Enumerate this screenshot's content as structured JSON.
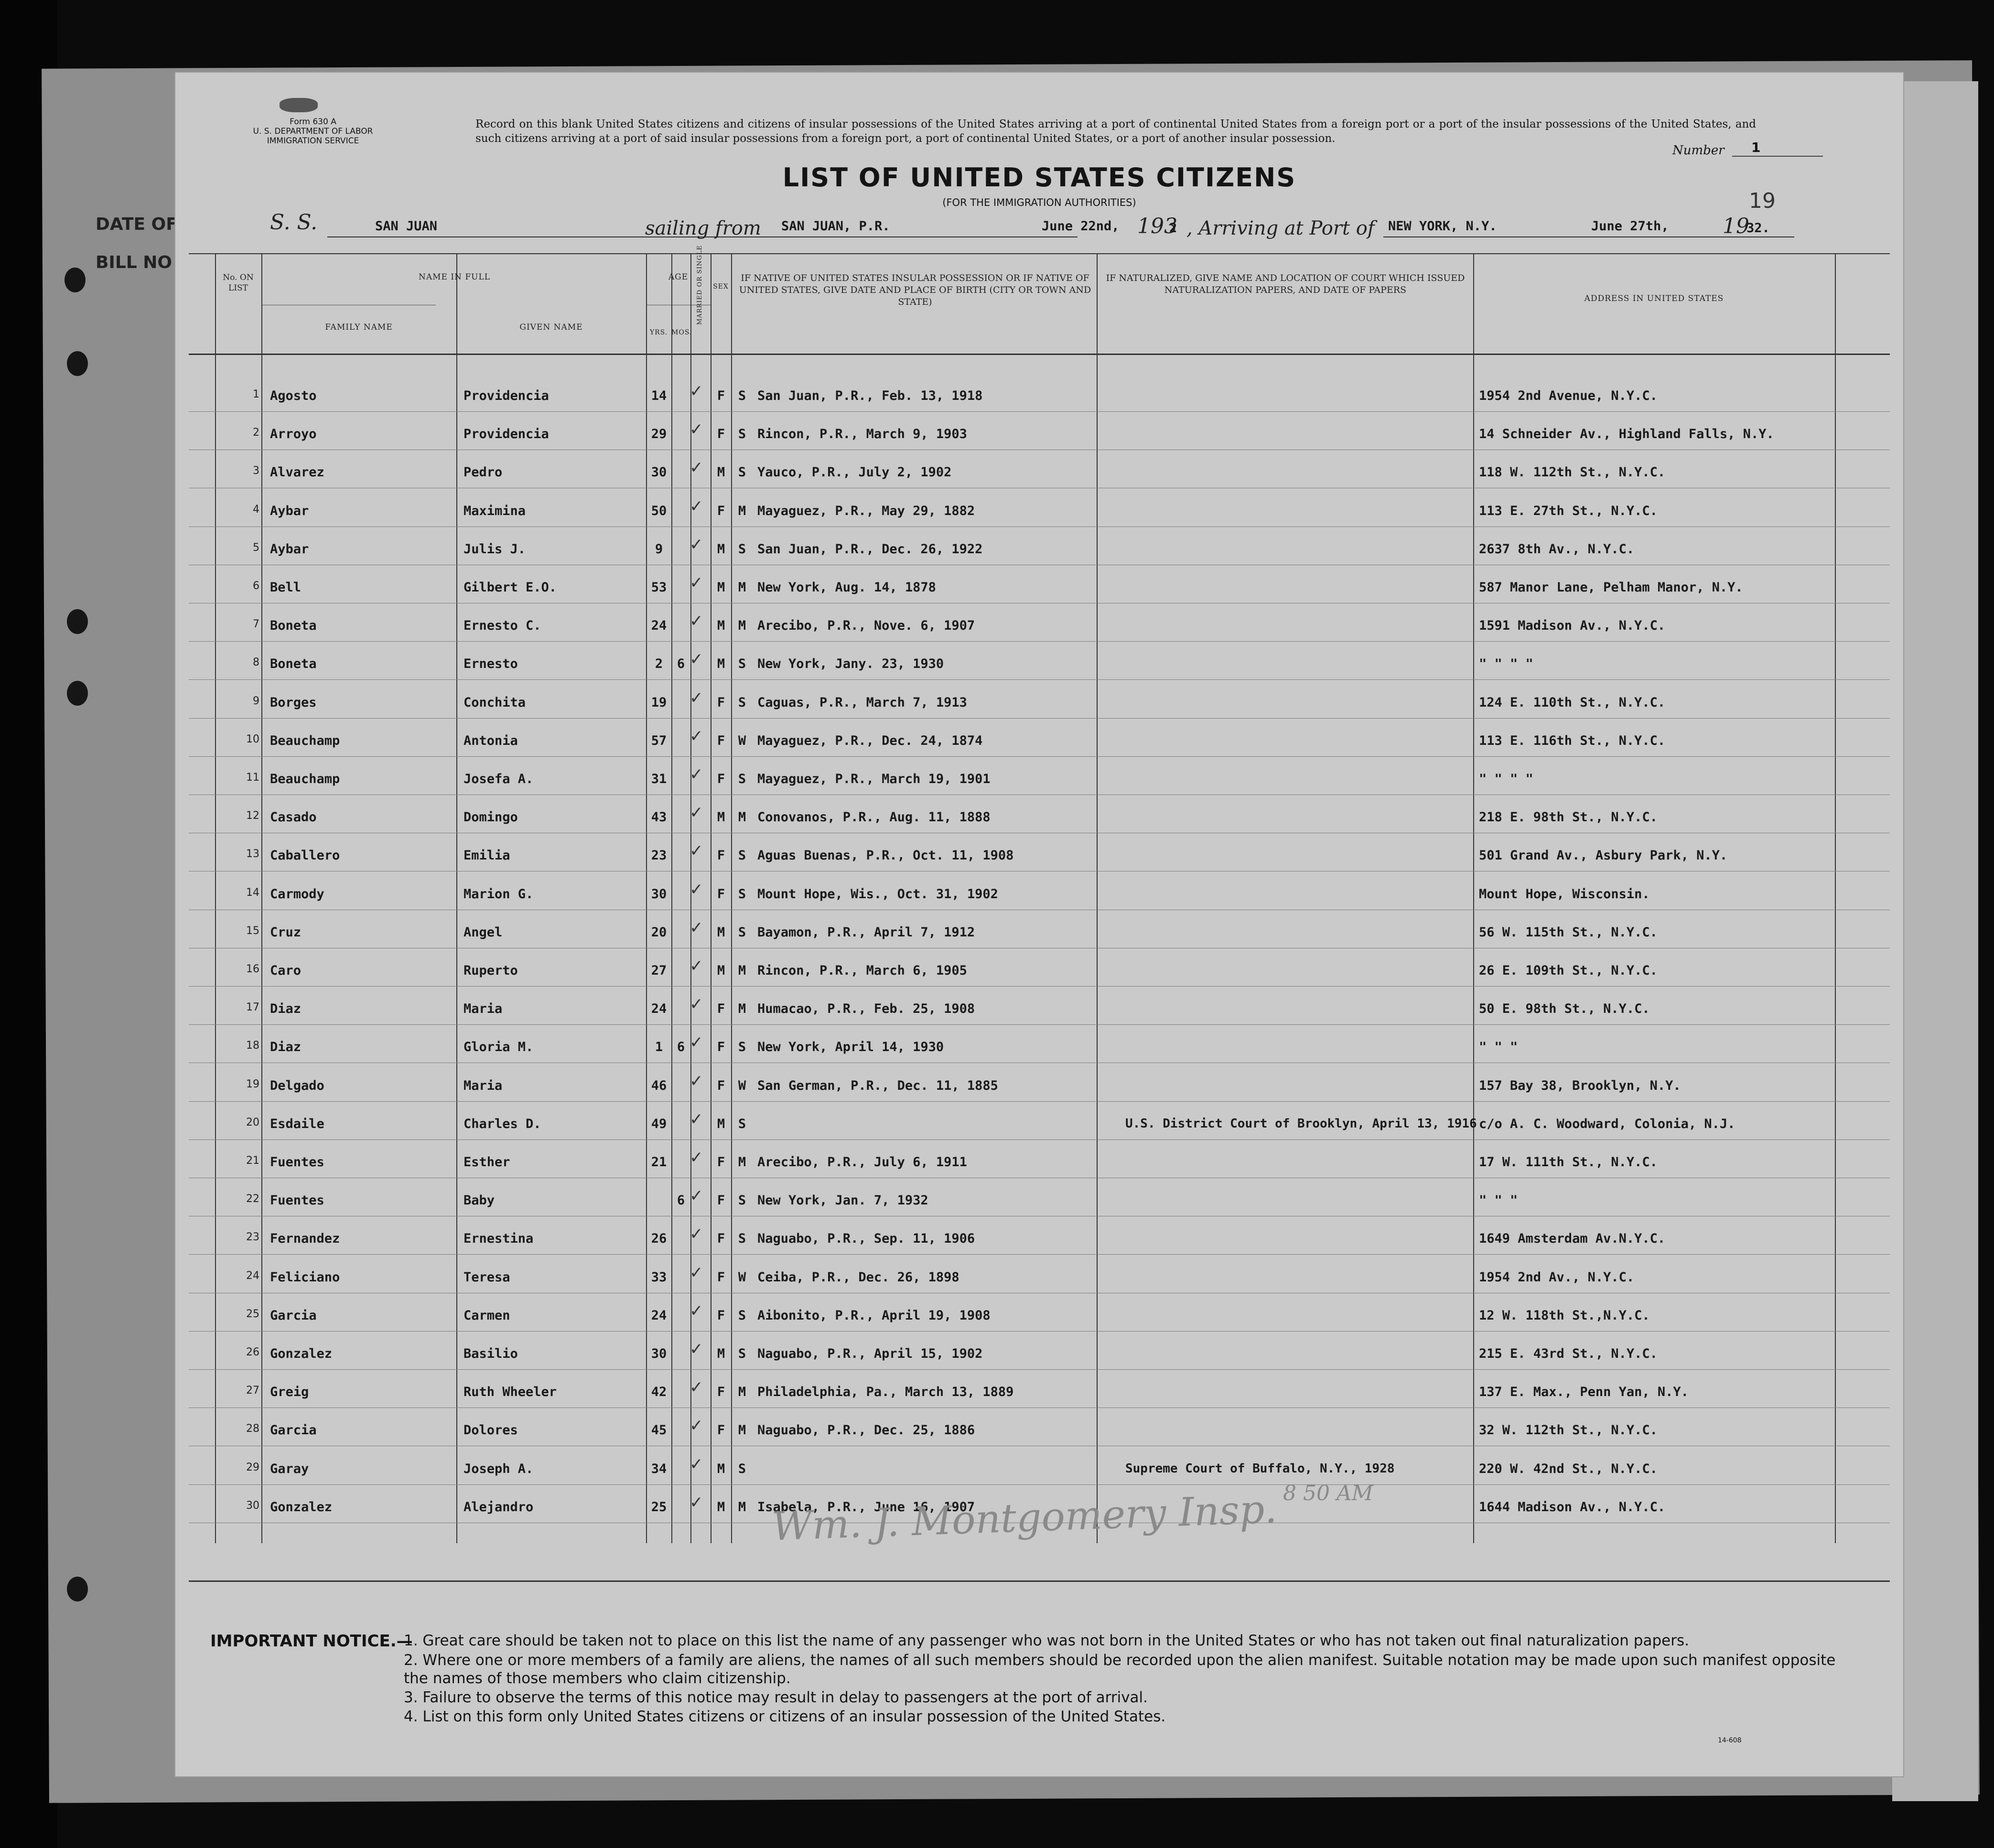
{
  "under_sheet": {
    "left_labels": [
      "DATE OF",
      "BILL NO"
    ]
  },
  "form": {
    "form_number": "Form 630 A",
    "department": "U. S. DEPARTMENT OF LABOR",
    "service": "IMMIGRATION SERVICE",
    "record_note": "Record on this blank United States citizens and citizens of insular possessions of the United States arriving at a port of continental United States from a foreign port or a port of the insular possessions of the United States, and such citizens arriving at a port of said insular possessions from a foreign port, a port of continental United States, or a port of another insular possession.",
    "number_label": "Number",
    "number_value": "1",
    "page_number": "19",
    "form_code": "14-608"
  },
  "title": "LIST OF UNITED STATES CITIZENS",
  "subtitle": "(FOR THE IMMIGRATION AUTHORITIES)",
  "voyage": {
    "ss_label": "S. S.",
    "ship": "SAN JUAN",
    "sailing_label": "sailing from",
    "from_port": "SAN JUAN, P.R.",
    "sail_date": "June 22nd,",
    "year_prefix": "193",
    "sail_year": "2",
    "arriving_label": ", Arriving at Port of",
    "to_port": "NEW YORK, N.Y.",
    "arrive_date": "June 27th,",
    "arrive_year_prefix": "19",
    "arrive_year": "32."
  },
  "headers": {
    "no_on_list": "No. ON LIST",
    "name_in_full": "NAME IN FULL",
    "family_name": "FAMILY NAME",
    "given_name": "GIVEN NAME",
    "age": "AGE",
    "yrs": "YRS.",
    "mos": "MOS.",
    "sex": "SEX",
    "married": "MARRIED OR SINGLE",
    "birth": "IF NATIVE OF UNITED STATES INSULAR POSSESSION OR IF NATIVE OF UNITED STATES, GIVE DATE AND PLACE OF BIRTH (CITY OR TOWN AND STATE)",
    "naturalized": "IF NATURALIZED, GIVE NAME AND LOCATION OF COURT WHICH ISSUED NATURALIZATION PAPERS, AND DATE OF PAPERS",
    "address": "ADDRESS IN UNITED STATES"
  },
  "passengers": [
    {
      "no": "1",
      "family": "Agosto",
      "given": "Providencia",
      "yrs": "14",
      "mos": "",
      "sex": "F",
      "ms": "S",
      "birth": "San Juan, P.R., Feb. 13, 1918",
      "nat": "",
      "addr": "1954 2nd Avenue, N.Y.C."
    },
    {
      "no": "2",
      "family": "Arroyo",
      "given": "Providencia",
      "yrs": "29",
      "mos": "",
      "sex": "F",
      "ms": "S",
      "birth": "Rincon, P.R., March 9, 1903",
      "nat": "",
      "addr": "14 Schneider Av., Highland Falls, N.Y."
    },
    {
      "no": "3",
      "family": "Alvarez",
      "given": "Pedro",
      "yrs": "30",
      "mos": "",
      "sex": "M",
      "ms": "S",
      "birth": "Yauco, P.R., July 2, 1902",
      "nat": "",
      "addr": "118 W. 112th St., N.Y.C."
    },
    {
      "no": "4",
      "family": "Aybar",
      "given": "Maximina",
      "yrs": "50",
      "mos": "",
      "sex": "F",
      "ms": "M",
      "birth": "Mayaguez, P.R., May 29, 1882",
      "nat": "",
      "addr": "113 E. 27th St., N.Y.C."
    },
    {
      "no": "5",
      "family": "Aybar",
      "given": "Julis J.",
      "yrs": "9",
      "mos": "",
      "sex": "M",
      "ms": "S",
      "birth": "San Juan, P.R., Dec. 26, 1922",
      "nat": "",
      "addr": "2637 8th Av., N.Y.C."
    },
    {
      "no": "6",
      "family": "Bell",
      "given": "Gilbert E.O.",
      "yrs": "53",
      "mos": "",
      "sex": "M",
      "ms": "M",
      "birth": "New York, Aug. 14, 1878",
      "nat": "",
      "addr": "587 Manor Lane, Pelham Manor, N.Y."
    },
    {
      "no": "7",
      "family": "Boneta",
      "given": "Ernesto C.",
      "yrs": "24",
      "mos": "",
      "sex": "M",
      "ms": "M",
      "birth": "Arecibo, P.R., Nove. 6, 1907",
      "nat": "",
      "addr": "1591 Madison Av., N.Y.C."
    },
    {
      "no": "8",
      "family": "Boneta",
      "given": "Ernesto",
      "yrs": "2",
      "mos": "6",
      "sex": "M",
      "ms": "S",
      "birth": "New York, Jany. 23, 1930",
      "nat": "",
      "addr": "\"    \"    \"    \""
    },
    {
      "no": "9",
      "family": "Borges",
      "given": "Conchita",
      "yrs": "19",
      "mos": "",
      "sex": "F",
      "ms": "S",
      "birth": "Caguas, P.R., March 7, 1913",
      "nat": "",
      "addr": "124 E. 110th St., N.Y.C."
    },
    {
      "no": "10",
      "family": "Beauchamp",
      "given": "Antonia",
      "yrs": "57",
      "mos": "",
      "sex": "F",
      "ms": "W",
      "birth": "Mayaguez, P.R., Dec. 24, 1874",
      "nat": "",
      "addr": "113 E. 116th St., N.Y.C."
    },
    {
      "no": "11",
      "family": "Beauchamp",
      "given": "Josefa A.",
      "yrs": "31",
      "mos": "",
      "sex": "F",
      "ms": "S",
      "birth": "Mayaguez, P.R., March 19, 1901",
      "nat": "",
      "addr": "\"    \"    \"    \""
    },
    {
      "no": "12",
      "family": "Casado",
      "given": "Domingo",
      "yrs": "43",
      "mos": "",
      "sex": "M",
      "ms": "M",
      "birth": "Conovanos, P.R., Aug. 11, 1888",
      "nat": "",
      "addr": "218 E. 98th St., N.Y.C."
    },
    {
      "no": "13",
      "family": "Caballero",
      "given": "Emilia",
      "yrs": "23",
      "mos": "",
      "sex": "F",
      "ms": "S",
      "birth": "Aguas Buenas, P.R., Oct. 11, 1908",
      "nat": "",
      "addr": "501 Grand Av., Asbury Park, N.Y."
    },
    {
      "no": "14",
      "family": "Carmody",
      "given": "Marion G.",
      "yrs": "30",
      "mos": "",
      "sex": "F",
      "ms": "S",
      "birth": "Mount Hope, Wis., Oct. 31, 1902",
      "nat": "",
      "addr": "Mount Hope, Wisconsin."
    },
    {
      "no": "15",
      "family": "Cruz",
      "given": "Angel",
      "yrs": "20",
      "mos": "",
      "sex": "M",
      "ms": "S",
      "birth": "Bayamon, P.R., April 7, 1912",
      "nat": "",
      "addr": "56 W. 115th St., N.Y.C."
    },
    {
      "no": "16",
      "family": "Caro",
      "given": "Ruperto",
      "yrs": "27",
      "mos": "",
      "sex": "M",
      "ms": "M",
      "birth": "Rincon, P.R., March 6, 1905",
      "nat": "",
      "addr": "26 E. 109th St., N.Y.C."
    },
    {
      "no": "17",
      "family": "Diaz",
      "given": "Maria",
      "yrs": "24",
      "mos": "",
      "sex": "F",
      "ms": "M",
      "birth": "Humacao, P.R., Feb. 25, 1908",
      "nat": "",
      "addr": "50 E. 98th St., N.Y.C."
    },
    {
      "no": "18",
      "family": "Diaz",
      "given": "Gloria M.",
      "yrs": "1",
      "mos": "6",
      "sex": "F",
      "ms": "S",
      "birth": "New York, April 14, 1930",
      "nat": "",
      "addr": "\"    \"    \""
    },
    {
      "no": "19",
      "family": "Delgado",
      "given": "Maria",
      "yrs": "46",
      "mos": "",
      "sex": "F",
      "ms": "W",
      "birth": "San German, P.R., Dec. 11, 1885",
      "nat": "",
      "addr": "157 Bay 38, Brooklyn, N.Y."
    },
    {
      "no": "20",
      "family": "Esdaile",
      "given": "Charles D.",
      "yrs": "49",
      "mos": "",
      "sex": "M",
      "ms": "S",
      "birth": "",
      "nat": "U.S. District Court of Brooklyn, April 13, 1916",
      "addr": "c/o A. C. Woodward, Colonia, N.J."
    },
    {
      "no": "21",
      "family": "Fuentes",
      "given": "Esther",
      "yrs": "21",
      "mos": "",
      "sex": "F",
      "ms": "M",
      "birth": "Arecibo, P.R., July 6, 1911",
      "nat": "",
      "addr": "17 W. 111th St., N.Y.C."
    },
    {
      "no": "22",
      "family": "Fuentes",
      "given": "Baby",
      "yrs": "",
      "mos": "6",
      "sex": "F",
      "ms": "S",
      "birth": "New York, Jan. 7, 1932",
      "nat": "",
      "addr": "\"    \"    \""
    },
    {
      "no": "23",
      "family": "Fernandez",
      "given": "Ernestina",
      "yrs": "26",
      "mos": "",
      "sex": "F",
      "ms": "S",
      "birth": "Naguabo, P.R., Sep. 11, 1906",
      "nat": "",
      "addr": "1649 Amsterdam Av.N.Y.C."
    },
    {
      "no": "24",
      "family": "Feliciano",
      "given": "Teresa",
      "yrs": "33",
      "mos": "",
      "sex": "F",
      "ms": "W",
      "birth": "Ceiba, P.R., Dec. 26, 1898",
      "nat": "",
      "addr": "1954 2nd Av., N.Y.C."
    },
    {
      "no": "25",
      "family": "Garcia",
      "given": "Carmen",
      "yrs": "24",
      "mos": "",
      "sex": "F",
      "ms": "S",
      "birth": "Aibonito, P.R., April 19, 1908",
      "nat": "",
      "addr": "12 W. 118th St.,N.Y.C."
    },
    {
      "no": "26",
      "family": "Gonzalez",
      "given": "Basilio",
      "yrs": "30",
      "mos": "",
      "sex": "M",
      "ms": "S",
      "birth": "Naguabo, P.R., April 15, 1902",
      "nat": "",
      "addr": "215 E. 43rd St., N.Y.C."
    },
    {
      "no": "27",
      "family": "Greig",
      "given": "Ruth Wheeler",
      "yrs": "42",
      "mos": "",
      "sex": "F",
      "ms": "M",
      "birth": "Philadelphia, Pa., March 13, 1889",
      "nat": "",
      "addr": "137 E. Max., Penn Yan, N.Y."
    },
    {
      "no": "28",
      "family": "Garcia",
      "given": "Dolores",
      "yrs": "45",
      "mos": "",
      "sex": "F",
      "ms": "M",
      "birth": "Naguabo, P.R., Dec. 25, 1886",
      "nat": "",
      "addr": "32 W. 112th St., N.Y.C."
    },
    {
      "no": "29",
      "family": "Garay",
      "given": "Joseph A.",
      "yrs": "34",
      "mos": "",
      "sex": "M",
      "ms": "S",
      "birth": "",
      "nat": "Supreme Court of Buffalo, N.Y., 1928",
      "addr": "220 W. 42nd St., N.Y.C."
    },
    {
      "no": "30",
      "family": "Gonzalez",
      "given": "Alejandro",
      "yrs": "25",
      "mos": "",
      "sex": "M",
      "ms": "M",
      "birth": "Isabela, P.R., June 16, 1907",
      "nat": "",
      "addr": "1644 Madison Av., N.Y.C."
    }
  ],
  "signature": {
    "text": "Wm. J. Montgomery Insp.",
    "time": "8 50 AM"
  },
  "notice": {
    "label": "IMPORTANT NOTICE.—",
    "items": [
      "1. Great care should be taken not to place on this list the name of any passenger who was not born in the United States or who has not taken out final naturalization papers.",
      "2. Where one or more members of a family are aliens, the names of all such members should be recorded upon the alien manifest.  Suitable notation may be made upon such manifest opposite the names of those members who claim citizenship.",
      "3. Failure to observe the terms of this notice may result in delay to passengers at the port of arrival.",
      "4. List on this form only United States citizens or citizens of an insular possession of the United States."
    ]
  }
}
